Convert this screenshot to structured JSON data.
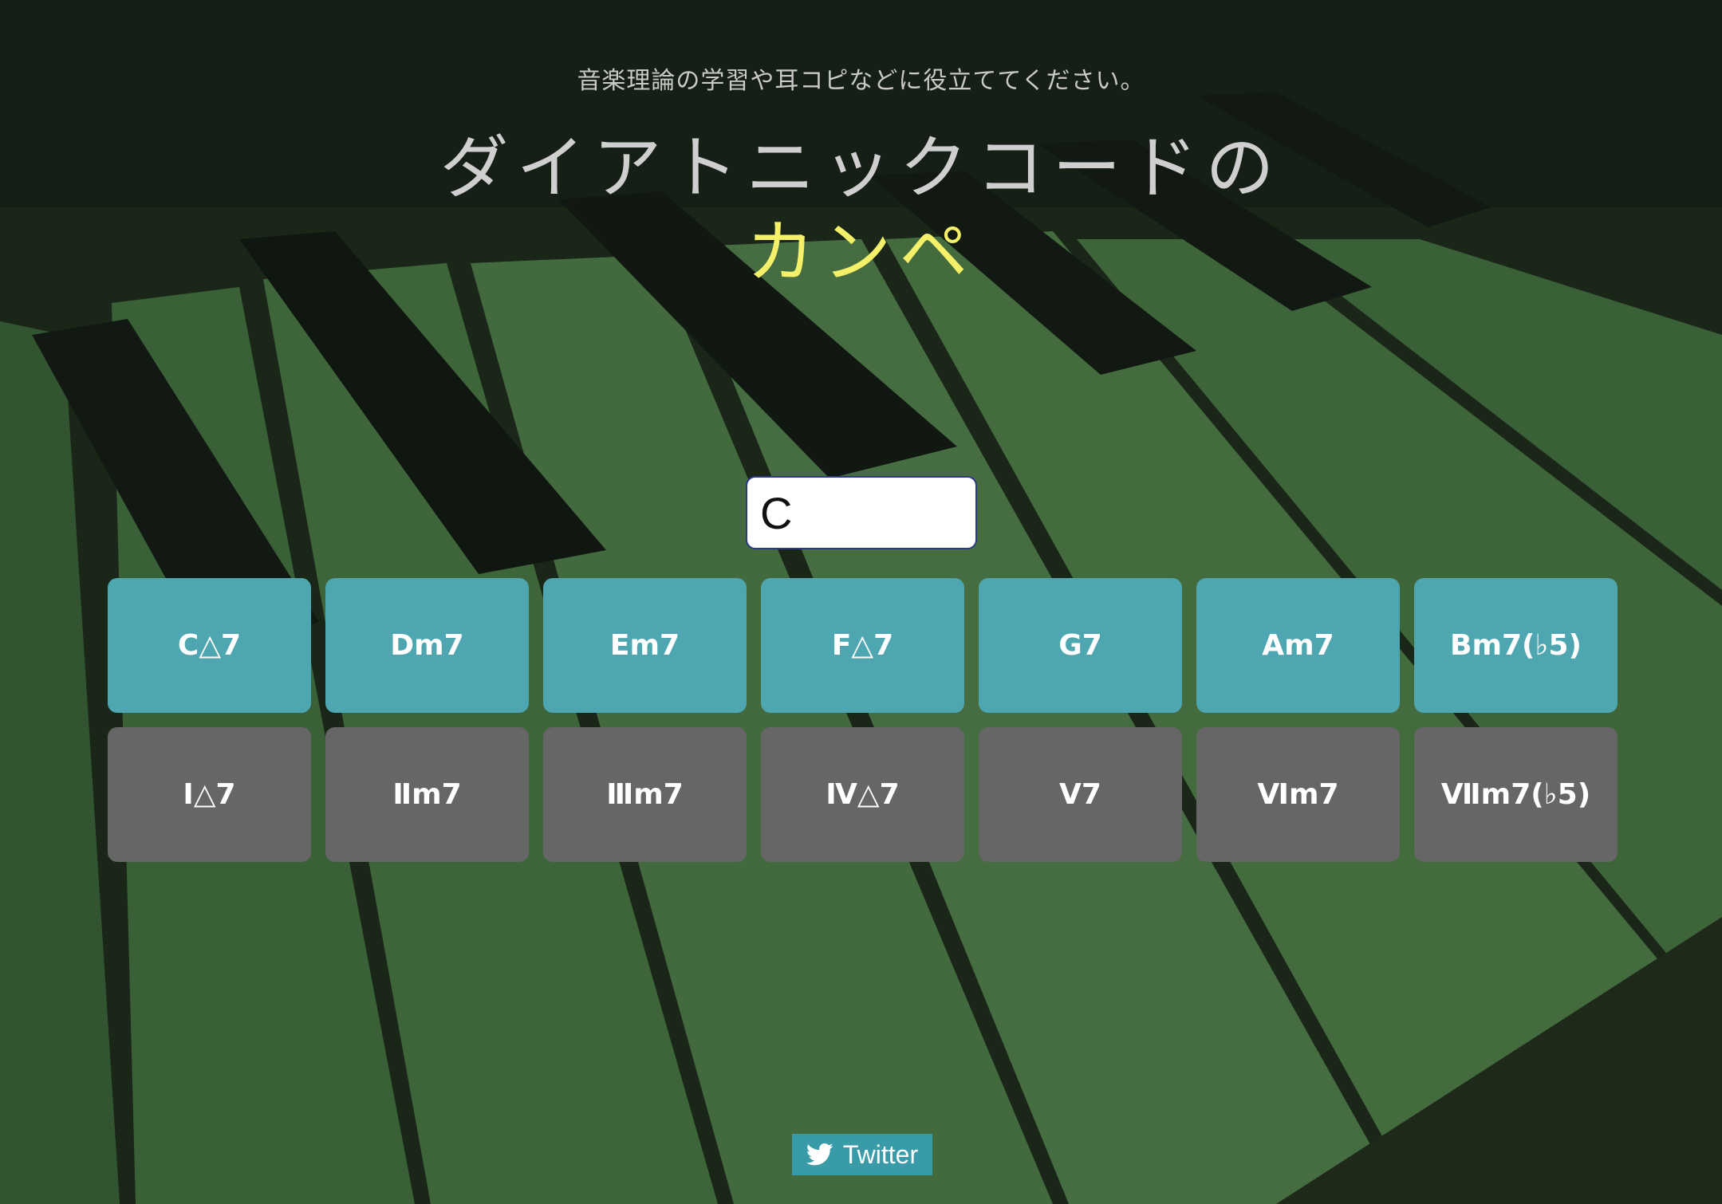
{
  "header": {
    "subtitle": "音楽理論の学習や耳コピなどに役立ててください。",
    "title_line1": "ダイアトニックコードの",
    "title_line2": "カンペ"
  },
  "key_input": {
    "value": "C"
  },
  "chords": [
    {
      "label": "C△7"
    },
    {
      "label": "Dm7"
    },
    {
      "label": "Em7"
    },
    {
      "label": "F△7"
    },
    {
      "label": "G7"
    },
    {
      "label": "Am7"
    },
    {
      "label": "Bm7(♭5)"
    }
  ],
  "degrees": [
    {
      "label": "Ⅰ△7"
    },
    {
      "label": "Ⅱm7"
    },
    {
      "label": "Ⅲm7"
    },
    {
      "label": "Ⅳ△7"
    },
    {
      "label": "Ⅴ7"
    },
    {
      "label": "Ⅵm7"
    },
    {
      "label": "Ⅶm7(♭5)"
    }
  ],
  "footer": {
    "twitter_label": "Twitter",
    "twitter_icon": "twitter-bird-icon"
  },
  "colors": {
    "chord_button": "#4ea6b0",
    "degree_button": "#666666",
    "title_accent": "#f4f06a",
    "twitter_button": "#3a9ba8"
  }
}
